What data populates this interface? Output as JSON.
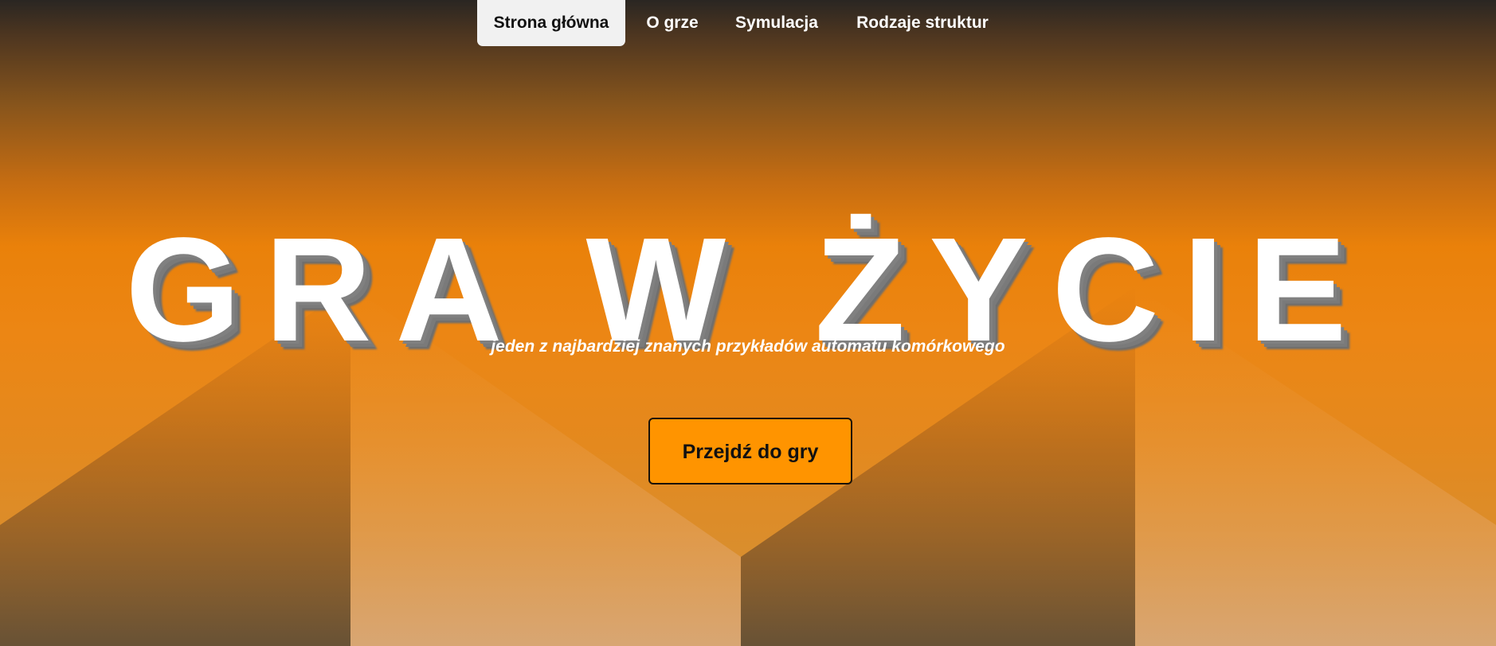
{
  "nav": {
    "items": [
      {
        "label": "Strona główna",
        "active": true
      },
      {
        "label": "O grze",
        "active": false
      },
      {
        "label": "Symulacja",
        "active": false
      },
      {
        "label": "Rodzaje struktur",
        "active": false
      }
    ]
  },
  "hero": {
    "title": "GRA W ŻYCIE",
    "tagline": "jeden z najbardziej znanych przykładów automatu komórkowego",
    "cta_label": "Przejdź do gry"
  },
  "colors": {
    "accent": "#ff9400",
    "nav_active_bg": "#f1f1f1",
    "hero_text": "#ffffff"
  }
}
